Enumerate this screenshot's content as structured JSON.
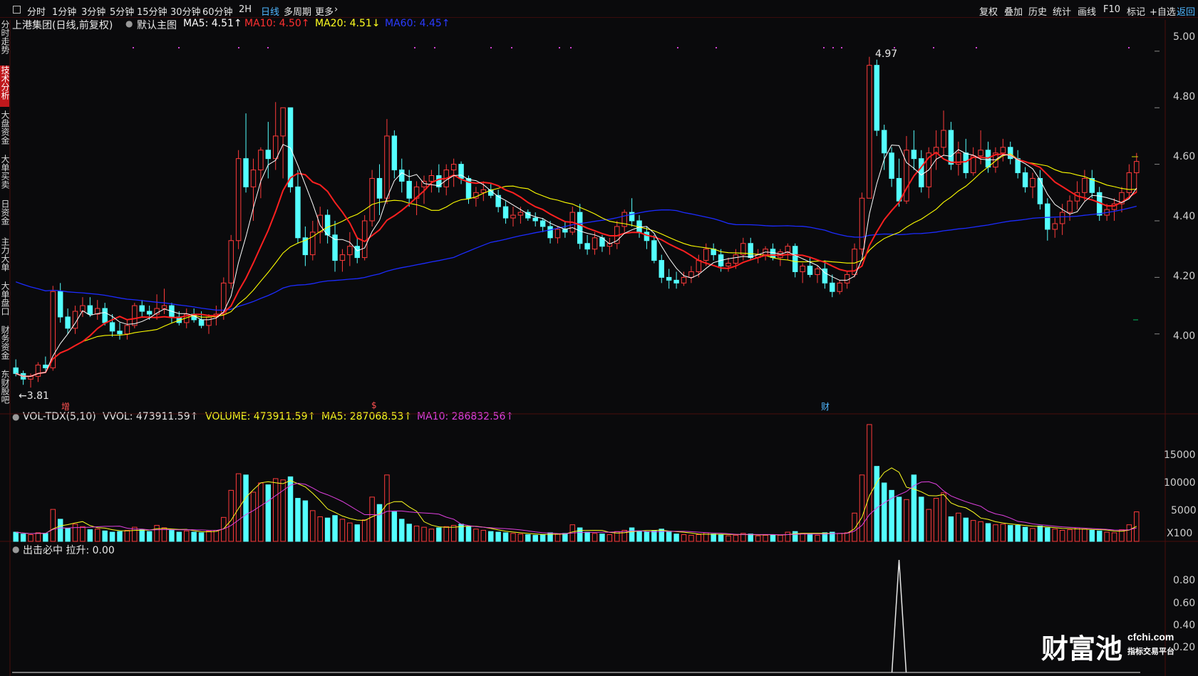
{
  "toolbar": {
    "checkbox_icon": "checkbox-icon",
    "tabs": [
      "分时",
      "1分钟",
      "3分钟",
      "5分钟",
      "15分钟",
      "30分钟",
      "60分钟",
      "2H",
      "日线",
      "多周期",
      "更多"
    ],
    "active_tab": "日线",
    "right_buttons": [
      "复权",
      "叠加",
      "历史",
      "统计",
      "画线",
      "F10",
      "标记",
      "+自选",
      "返回"
    ]
  },
  "sidebar": {
    "items": [
      "分时走势",
      "技术分析",
      "大盘资金",
      "大单买卖",
      "日资金",
      "主力大单",
      "大单盘口",
      "财务资金",
      "东财股吧"
    ],
    "active": "技术分析"
  },
  "main_panel": {
    "stock_title": "上港集团(日线,前复权)",
    "template_label": "默认主图",
    "ma5": "MA5: 4.51↑",
    "ma10": "MA10: 4.50↑",
    "ma20": "MA20: 4.51↓",
    "ma60": "MA60: 4.45↑",
    "high_marker": "4.97",
    "low_marker": "←3.81",
    "event_markers": [
      "增",
      "$",
      "财"
    ],
    "y_axis": [
      "5.00",
      "4.80",
      "4.60",
      "4.40",
      "4.20",
      "4.00"
    ],
    "colors": {
      "ma5": "#ffffff",
      "ma10": "#ff2020",
      "ma20": "#ffff00",
      "ma60": "#1c2bff",
      "up": "#ff3b3b",
      "down": "#54ffff"
    }
  },
  "vol_panel": {
    "indicator": "VOL-TDX(5,10)",
    "vvol": "VVOL: 473911.59↑",
    "volume": "VOLUME: 473911.59↑",
    "ma5": "MA5: 287068.53↑",
    "ma10": "MA10: 286832.56↑",
    "y_axis": [
      "15000",
      "10000",
      "5000"
    ],
    "unit": "X100"
  },
  "sig_panel": {
    "title": "出击必中  拉升: 0.00",
    "y_axis": [
      "0.80",
      "0.60",
      "0.40",
      "0.20"
    ]
  },
  "watermark": {
    "brand": "财富池",
    "domain": "cfchi.com",
    "slogan": "指标交易平台"
  },
  "chart_data": {
    "type": "candlestick",
    "ylim": [
      3.75,
      5.05
    ],
    "vol_ylim": [
      0,
      19000
    ],
    "candles": [
      [
        3.88,
        3.91,
        3.85,
        3.86,
        1500
      ],
      [
        3.86,
        3.87,
        3.82,
        3.84,
        1200
      ],
      [
        3.84,
        3.86,
        3.81,
        3.85,
        1100
      ],
      [
        3.85,
        3.9,
        3.83,
        3.89,
        1400
      ],
      [
        3.89,
        3.92,
        3.87,
        3.88,
        1300
      ],
      [
        3.88,
        4.17,
        3.87,
        4.15,
        5200
      ],
      [
        4.15,
        4.18,
        4.04,
        4.06,
        3600
      ],
      [
        4.06,
        4.09,
        4.0,
        4.02,
        2100
      ],
      [
        4.02,
        4.1,
        4.0,
        4.08,
        2800
      ],
      [
        4.08,
        4.13,
        4.06,
        4.1,
        2400
      ],
      [
        4.1,
        4.13,
        4.06,
        4.07,
        1900
      ],
      [
        4.07,
        4.12,
        4.05,
        4.09,
        2000
      ],
      [
        4.09,
        4.11,
        4.03,
        4.04,
        1700
      ],
      [
        4.04,
        4.07,
        3.99,
        4.01,
        1500
      ],
      [
        4.01,
        4.04,
        3.98,
        4.0,
        1600
      ],
      [
        4.0,
        4.05,
        3.98,
        4.03,
        1800
      ],
      [
        4.03,
        4.11,
        4.02,
        4.1,
        2300
      ],
      [
        4.1,
        4.12,
        4.06,
        4.08,
        1900
      ],
      [
        4.08,
        4.1,
        4.05,
        4.07,
        1600
      ],
      [
        4.07,
        4.14,
        4.05,
        4.09,
        2600
      ],
      [
        4.09,
        4.16,
        4.07,
        4.1,
        2200
      ],
      [
        4.1,
        4.11,
        4.04,
        4.06,
        1800
      ],
      [
        4.06,
        4.08,
        4.03,
        4.04,
        1500
      ],
      [
        4.04,
        4.09,
        4.02,
        4.07,
        1700
      ],
      [
        4.07,
        4.09,
        4.04,
        4.05,
        1500
      ],
      [
        4.05,
        4.08,
        4.02,
        4.03,
        1400
      ],
      [
        4.03,
        4.07,
        4.0,
        4.06,
        1700
      ],
      [
        4.06,
        4.1,
        4.03,
        4.07,
        1800
      ],
      [
        4.07,
        4.2,
        4.05,
        4.18,
        3900
      ],
      [
        4.18,
        4.35,
        4.16,
        4.33,
        8300
      ],
      [
        4.33,
        4.65,
        4.3,
        4.62,
        11000
      ],
      [
        4.62,
        4.78,
        4.5,
        4.52,
        10800
      ],
      [
        4.52,
        4.62,
        4.4,
        4.58,
        8000
      ],
      [
        4.58,
        4.66,
        4.48,
        4.65,
        9500
      ],
      [
        4.65,
        4.75,
        4.55,
        4.62,
        9200
      ],
      [
        4.62,
        4.82,
        4.58,
        4.7,
        10200
      ],
      [
        4.7,
        4.8,
        4.55,
        4.8,
        10000
      ],
      [
        4.8,
        4.72,
        4.5,
        4.52,
        10500
      ],
      [
        4.52,
        4.58,
        4.32,
        4.34,
        7000
      ],
      [
        4.34,
        4.38,
        4.24,
        4.28,
        6600
      ],
      [
        4.28,
        4.4,
        4.26,
        4.36,
        5000
      ],
      [
        4.36,
        4.45,
        4.32,
        4.42,
        4000
      ],
      [
        4.42,
        4.44,
        4.32,
        4.35,
        3800
      ],
      [
        4.35,
        4.4,
        4.22,
        4.26,
        4200
      ],
      [
        4.26,
        4.3,
        4.22,
        4.28,
        3600
      ],
      [
        4.28,
        4.36,
        4.24,
        4.31,
        3000
      ],
      [
        4.31,
        4.34,
        4.25,
        4.27,
        2700
      ],
      [
        4.27,
        4.42,
        4.26,
        4.4,
        3500
      ],
      [
        4.4,
        4.58,
        4.38,
        4.55,
        7200
      ],
      [
        4.55,
        4.6,
        4.42,
        4.48,
        6000
      ],
      [
        4.48,
        4.76,
        4.46,
        4.7,
        10800
      ],
      [
        4.7,
        4.72,
        4.55,
        4.58,
        4800
      ],
      [
        4.58,
        4.62,
        4.5,
        4.54,
        3600
      ],
      [
        4.54,
        4.58,
        4.45,
        4.48,
        2800
      ],
      [
        4.48,
        4.54,
        4.42,
        4.52,
        2500
      ],
      [
        4.52,
        4.56,
        4.46,
        4.54,
        2300
      ],
      [
        4.54,
        4.58,
        4.5,
        4.56,
        2000
      ],
      [
        4.56,
        4.6,
        4.5,
        4.52,
        2200
      ],
      [
        4.52,
        4.6,
        4.49,
        4.58,
        2400
      ],
      [
        4.58,
        4.62,
        4.52,
        4.6,
        2600
      ],
      [
        4.6,
        4.61,
        4.53,
        4.55,
        2800
      ],
      [
        4.55,
        4.56,
        4.46,
        4.48,
        2400
      ],
      [
        4.48,
        4.52,
        4.45,
        4.5,
        2000
      ],
      [
        4.5,
        4.54,
        4.47,
        4.51,
        1800
      ],
      [
        4.51,
        4.53,
        4.48,
        4.49,
        1600
      ],
      [
        4.49,
        4.51,
        4.43,
        4.45,
        1500
      ],
      [
        4.45,
        4.47,
        4.39,
        4.41,
        1400
      ],
      [
        4.41,
        4.45,
        4.38,
        4.42,
        1300
      ],
      [
        4.42,
        4.45,
        4.39,
        4.43,
        1200
      ],
      [
        4.43,
        4.44,
        4.4,
        4.41,
        1100
      ],
      [
        4.41,
        4.43,
        4.38,
        4.4,
        1000
      ],
      [
        4.4,
        4.41,
        4.36,
        4.38,
        1100
      ],
      [
        4.38,
        4.4,
        4.32,
        4.34,
        1400
      ],
      [
        4.34,
        4.38,
        4.32,
        4.37,
        1200
      ],
      [
        4.37,
        4.4,
        4.34,
        4.36,
        1300
      ],
      [
        4.36,
        4.45,
        4.35,
        4.43,
        2700
      ],
      [
        4.43,
        4.46,
        4.3,
        4.32,
        2200
      ],
      [
        4.32,
        4.35,
        4.28,
        4.3,
        1500
      ],
      [
        4.3,
        4.36,
        4.28,
        4.34,
        1300
      ],
      [
        4.34,
        4.35,
        4.29,
        4.31,
        1200
      ],
      [
        4.31,
        4.34,
        4.28,
        4.32,
        1100
      ],
      [
        4.32,
        4.4,
        4.3,
        4.38,
        1600
      ],
      [
        4.38,
        4.44,
        4.36,
        4.43,
        1800
      ],
      [
        4.43,
        4.48,
        4.38,
        4.4,
        2200
      ],
      [
        4.4,
        4.42,
        4.34,
        4.36,
        1700
      ],
      [
        4.36,
        4.38,
        4.3,
        4.33,
        1500
      ],
      [
        4.33,
        4.35,
        4.25,
        4.26,
        1700
      ],
      [
        4.26,
        4.28,
        4.18,
        4.2,
        2000
      ],
      [
        4.2,
        4.23,
        4.16,
        4.19,
        1500
      ],
      [
        4.19,
        4.22,
        4.16,
        4.18,
        1200
      ],
      [
        4.18,
        4.22,
        4.17,
        4.2,
        1100
      ],
      [
        4.2,
        4.24,
        4.18,
        4.22,
        1000
      ],
      [
        4.22,
        4.28,
        4.2,
        4.26,
        1100
      ],
      [
        4.26,
        4.32,
        4.24,
        4.3,
        1400
      ],
      [
        4.3,
        4.32,
        4.26,
        4.28,
        1200
      ],
      [
        4.28,
        4.3,
        4.22,
        4.24,
        1100
      ],
      [
        4.24,
        4.27,
        4.22,
        4.25,
        900
      ],
      [
        4.25,
        4.3,
        4.23,
        4.28,
        1000
      ],
      [
        4.28,
        4.34,
        4.26,
        4.32,
        1300
      ],
      [
        4.32,
        4.34,
        4.26,
        4.27,
        1200
      ],
      [
        4.27,
        4.3,
        4.25,
        4.28,
        900
      ],
      [
        4.28,
        4.31,
        4.26,
        4.3,
        1000
      ],
      [
        4.3,
        4.32,
        4.26,
        4.27,
        1100
      ],
      [
        4.27,
        4.3,
        4.24,
        4.29,
        1000
      ],
      [
        4.29,
        4.32,
        4.26,
        4.31,
        1500
      ],
      [
        4.31,
        4.32,
        4.2,
        4.22,
        1600
      ],
      [
        4.22,
        4.25,
        4.18,
        4.24,
        1300
      ],
      [
        4.24,
        4.27,
        4.2,
        4.21,
        1200
      ],
      [
        4.21,
        4.24,
        4.18,
        4.23,
        1000
      ],
      [
        4.23,
        4.26,
        4.16,
        4.18,
        1400
      ],
      [
        4.18,
        4.21,
        4.13,
        4.15,
        1500
      ],
      [
        4.15,
        4.19,
        4.14,
        4.18,
        1300
      ],
      [
        4.18,
        4.22,
        4.16,
        4.21,
        1400
      ],
      [
        4.21,
        4.32,
        4.2,
        4.3,
        4600
      ],
      [
        4.3,
        4.5,
        4.28,
        4.48,
        10800
      ],
      [
        4.48,
        4.98,
        4.48,
        4.95,
        19000
      ],
      [
        4.95,
        4.97,
        4.7,
        4.72,
        12200
      ],
      [
        4.72,
        4.74,
        4.58,
        4.64,
        9500
      ],
      [
        4.64,
        4.66,
        4.52,
        4.55,
        8300
      ],
      [
        4.55,
        4.62,
        4.45,
        4.47,
        7200
      ],
      [
        4.47,
        4.7,
        4.46,
        4.65,
        6800
      ],
      [
        4.65,
        4.72,
        4.58,
        4.62,
        10800
      ],
      [
        4.62,
        4.65,
        4.5,
        4.52,
        7200
      ],
      [
        4.52,
        4.66,
        4.48,
        4.64,
        5200
      ],
      [
        4.64,
        4.72,
        4.58,
        4.66,
        7000
      ],
      [
        4.66,
        4.79,
        4.63,
        4.72,
        7900
      ],
      [
        4.72,
        4.75,
        4.58,
        4.6,
        4000
      ],
      [
        4.6,
        4.68,
        4.56,
        4.64,
        4600
      ],
      [
        4.64,
        4.69,
        4.55,
        4.57,
        3800
      ],
      [
        4.57,
        4.66,
        4.56,
        4.63,
        3400
      ],
      [
        4.63,
        4.72,
        4.6,
        4.65,
        3200
      ],
      [
        4.65,
        4.68,
        4.57,
        4.59,
        2900
      ],
      [
        4.59,
        4.66,
        4.57,
        4.64,
        2700
      ],
      [
        4.64,
        4.69,
        4.61,
        4.66,
        2800
      ],
      [
        4.66,
        4.68,
        4.6,
        4.62,
        2600
      ],
      [
        4.62,
        4.65,
        4.55,
        4.57,
        2600
      ],
      [
        4.57,
        4.59,
        4.5,
        4.52,
        2300
      ],
      [
        4.52,
        4.57,
        4.48,
        4.55,
        2100
      ],
      [
        4.55,
        4.58,
        4.44,
        4.46,
        2500
      ],
      [
        4.46,
        4.48,
        4.33,
        4.37,
        2200
      ],
      [
        4.37,
        4.41,
        4.34,
        4.39,
        2000
      ],
      [
        4.39,
        4.46,
        4.35,
        4.43,
        1800
      ],
      [
        4.43,
        4.49,
        4.4,
        4.47,
        1900
      ],
      [
        4.47,
        4.54,
        4.44,
        4.5,
        2200
      ],
      [
        4.5,
        4.58,
        4.47,
        4.55,
        2000
      ],
      [
        4.55,
        4.58,
        4.48,
        4.5,
        1800
      ],
      [
        4.5,
        4.52,
        4.4,
        4.42,
        1700
      ],
      [
        4.42,
        4.46,
        4.4,
        4.44,
        1500
      ],
      [
        4.44,
        4.48,
        4.4,
        4.46,
        1400
      ],
      [
        4.46,
        4.52,
        4.43,
        4.5,
        1900
      ],
      [
        4.5,
        4.6,
        4.48,
        4.57,
        2700
      ],
      [
        4.57,
        4.64,
        4.5,
        4.61,
        4800
      ]
    ],
    "signal_spike_index": 119
  }
}
